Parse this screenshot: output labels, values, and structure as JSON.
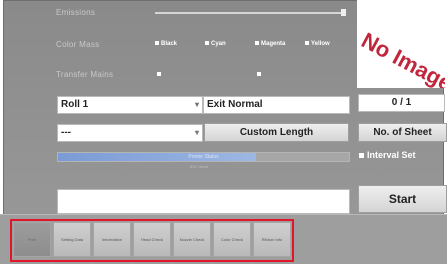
{
  "settings": {
    "row1_label": "Emissions",
    "row2_label": "Color Mass",
    "row3_label": "Transfer Mains",
    "color_options": [
      "Black",
      "Cyan",
      "Magenta",
      "Yellow"
    ]
  },
  "preview": {
    "text": "No Image"
  },
  "roll": {
    "selected": "Roll 1"
  },
  "exit": {
    "value": "Exit Normal"
  },
  "counter": {
    "value": "0 / 1"
  },
  "length": {
    "selected": "---"
  },
  "buttons": {
    "custom_length": "Custom Length",
    "no_of_sheet": "No. of Sheet",
    "start": "Start"
  },
  "progress": {
    "value": 0.68,
    "label": "Printer Status",
    "sub": "0% / 0mm"
  },
  "interval_set": {
    "label": "Interval Set",
    "checked": false
  },
  "message": {
    "value": ""
  },
  "tabs": [
    {
      "label": "Print",
      "active": true
    },
    {
      "label": "Setting Data"
    },
    {
      "label": "Information"
    },
    {
      "label": "Head Check"
    },
    {
      "label": "Nozzle Check"
    },
    {
      "label": "Color Check"
    },
    {
      "label": "Ribbon Info"
    }
  ],
  "colors": {
    "highlight": "#e0162b",
    "progress": "#8aa9dd",
    "preview_text": "#c0263c"
  }
}
